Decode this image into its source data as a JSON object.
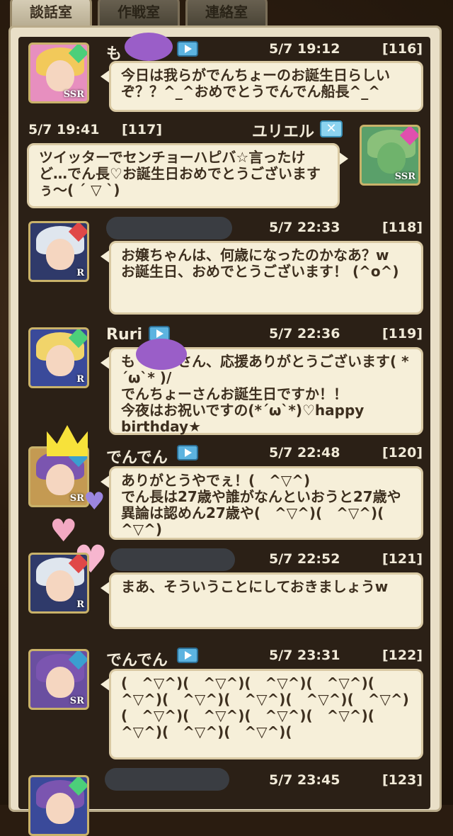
{
  "tabs": [
    "談話室",
    "作戦室",
    "連絡室"
  ],
  "messages": [
    {
      "id": "m116",
      "side": "left",
      "name": "も",
      "time": "5/7 19:12",
      "index": "[116]",
      "text": "今日は我らがでんちょーのお誕生日らしいぞ？？^_^おめでとうでんでん船長^_^",
      "rank": "SSR",
      "avatar_color": "#e78fbf",
      "gem_color": "#4ccf7a"
    },
    {
      "id": "m117",
      "side": "right",
      "name": "ユリエル",
      "time": "5/7 19:41",
      "index": "[117]",
      "text": "ツイッターでセンチョーハピバ☆言ったけど…でん長♡お誕生日おめでとうございますぅ〜( ´ ▽ `)",
      "rank": "SSR",
      "avatar_color": "#5aa06a",
      "gem_color": "#e04fae"
    },
    {
      "id": "m118",
      "side": "left",
      "name": "",
      "time": "5/7 22:33",
      "index": "[118]",
      "text": "お嬢ちゃんは、何歳になったのかなあ？w\nお誕生日、おめでとうございます！ (^o^)",
      "rank": "R",
      "avatar_color": "#2f3a6a",
      "gem_color": "#e04848"
    },
    {
      "id": "m119",
      "side": "left",
      "name": "Ruri",
      "time": "5/7 22:36",
      "index": "[119]",
      "text": "も　　　さん、応援ありがとうございます( *´ω`* )/\nでんちょーさんお誕生日ですか！！\n今夜はお祝いですの(*´ω`*)♡happy birthday★",
      "rank": "R",
      "avatar_color": "#3a4a9a",
      "gem_color": "#4ccf7a"
    },
    {
      "id": "m120",
      "side": "left",
      "name": "でんでん",
      "time": "5/7 22:48",
      "index": "[120]",
      "text": "ありがとうやでぇ！(　^▽^)\nでん長は27歳や誰がなんといおうと27歳や異論は認めん27歳や(　^▽^)(　^▽^)(　^▽^)",
      "rank": "SR",
      "avatar_color": "#c49a52",
      "gem_color": "#3a9fd0"
    },
    {
      "id": "m121",
      "side": "left",
      "name": "",
      "time": "5/7 22:52",
      "index": "[121]",
      "text": "まあ、そういうことにしておきましょうw",
      "rank": "R",
      "avatar_color": "#2f3a6a",
      "gem_color": "#e04848"
    },
    {
      "id": "m122",
      "side": "left",
      "name": "でんでん",
      "time": "5/7 23:31",
      "index": "[122]",
      "text": "(　^▽^)(　^▽^)(　^▽^)(　^▽^)(　^▽^)(　^▽^)(　^▽^)(　^▽^)(　^▽^)(　^▽^)(　^▽^)(　^▽^)(　^▽^)(　^▽^)(　^▽^)(　^▽^)(",
      "rank": "SR",
      "avatar_color": "#6a4fa0",
      "gem_color": "#3a9fd0"
    },
    {
      "id": "m123",
      "side": "left",
      "name": "",
      "time": "5/7 23:45",
      "index": "[123]",
      "text": "",
      "rank": "",
      "avatar_color": "#3a4a9a",
      "gem_color": "#4ccf7a"
    }
  ]
}
